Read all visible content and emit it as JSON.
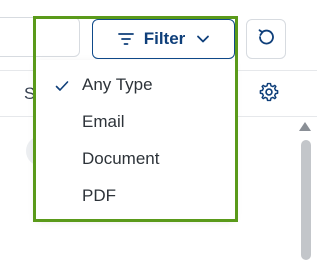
{
  "toolbar": {
    "filter_label": "Filter"
  },
  "table_header": {
    "partial_text": "S"
  },
  "filter_menu": {
    "items": [
      {
        "label": "Any Type",
        "selected": true
      },
      {
        "label": "Email",
        "selected": false
      },
      {
        "label": "Document",
        "selected": false
      },
      {
        "label": "PDF",
        "selected": false
      }
    ]
  },
  "colors": {
    "accent": "#0f4a8a",
    "highlight": "#5a9a1a"
  },
  "icons": {
    "filter": "filter-lines-icon",
    "chevron": "chevron-down-icon",
    "refresh": "refresh-icon",
    "settings": "gear-icon",
    "check": "check-icon"
  }
}
